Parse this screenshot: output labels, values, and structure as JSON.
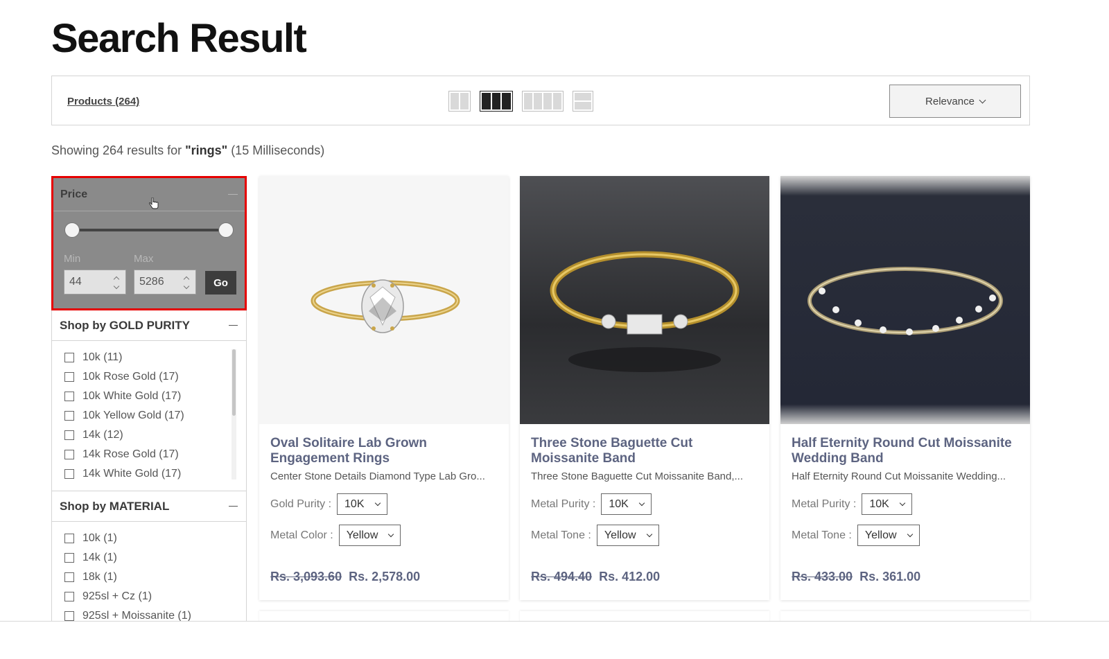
{
  "page": {
    "title": "Search Result"
  },
  "toolbar": {
    "products_label": "Products (264)",
    "sort_label": "Relevance",
    "view_options": [
      "2-column",
      "3-column",
      "4-column",
      "list"
    ],
    "active_view": "3-column"
  },
  "results": {
    "prefix": "Showing 264 results for ",
    "query": "\"rings\"",
    "suffix": " (15 Milliseconds)"
  },
  "filters": {
    "price": {
      "title": "Price",
      "min_label": "Min",
      "max_label": "Max",
      "min_value": "44",
      "max_value": "5286",
      "go_label": "Go"
    },
    "gold_purity": {
      "title_prefix": "Shop by ",
      "title_strong": "GOLD PURITY",
      "items": [
        "10k (11)",
        "10k Rose Gold (17)",
        "10k White Gold (17)",
        "10k Yellow Gold (17)",
        "14k (12)",
        "14k Rose Gold (17)",
        "14k White Gold (17)"
      ]
    },
    "material": {
      "title_prefix": "Shop by ",
      "title_strong": "MATERIAL",
      "items": [
        "10k (1)",
        "14k (1)",
        "18k (1)",
        "925sl + Cz (1)",
        "925sl + Moissanite (1)"
      ]
    }
  },
  "products": [
    {
      "title": "Oval Solitaire Lab Grown Engagement Rings",
      "desc": "Center Stone Details Diamond Type Lab Gro...",
      "opt1_label": "Gold Purity :",
      "opt1_value": "10K",
      "opt2_label": "Metal Color :",
      "opt2_value": "Yellow",
      "old_price": "Rs. 3,093.60",
      "new_price": "Rs. 2,578.00"
    },
    {
      "title": "Three Stone Baguette Cut Moissanite Band",
      "desc": "Three Stone Baguette Cut Moissanite Band,...",
      "opt1_label": "Metal Purity :",
      "opt1_value": "10K",
      "opt2_label": "Metal Tone :",
      "opt2_value": "Yellow",
      "old_price": "Rs. 494.40",
      "new_price": "Rs. 412.00"
    },
    {
      "title": "Half Eternity Round Cut Moissanite Wedding Band",
      "desc": "Half Eternity Round Cut Moissanite Wedding...",
      "opt1_label": "Metal Purity :",
      "opt1_value": "10K",
      "opt2_label": "Metal Tone :",
      "opt2_value": "Yellow",
      "old_price": "Rs. 433.00",
      "new_price": "Rs. 361.00"
    }
  ],
  "colors": {
    "title_accent": "#5d6481",
    "highlight_border": "#e60000",
    "price_panel_bg": "#8a8a8a"
  }
}
